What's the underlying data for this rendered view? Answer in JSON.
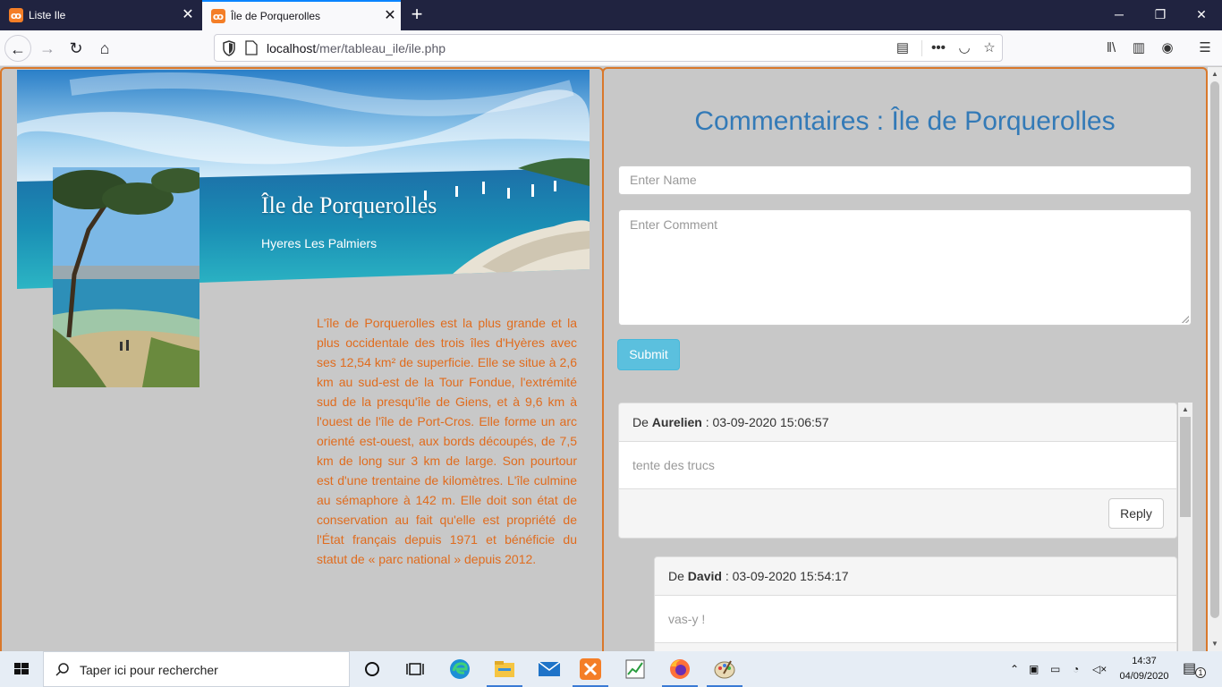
{
  "browser": {
    "tabs": [
      {
        "title": "Liste Ile",
        "active": false,
        "favicon": "xampp-icon"
      },
      {
        "title": "Île de Porquerolles",
        "active": true,
        "favicon": "xampp-icon"
      }
    ],
    "url_host": "localhost",
    "url_path": "/mer/tableau_ile/ile.php"
  },
  "island": {
    "title": "Île de Porquerolles",
    "subtitle": "Hyeres Les Palmiers",
    "description": "L'île de Porquerolles est la plus grande et la plus occidentale des trois îles d'Hyères avec ses 12,54 km² de superficie. Elle se situe à 2,6 km au sud-est de la Tour Fondue, l'extrémité sud de la presqu'île de Giens, et à 9,6 km à l'ouest de l'île de Port-Cros. Elle forme un arc orienté est-ouest, aux bords découpés, de 7,5 km de long sur 3 km de large. Son pourtour est d'une trentaine de kilomètres. L'île culmine au sémaphore à 142 m. Elle doit son état de conservation au fait qu'elle est propriété de l'État français depuis 1971 et bénéficie du statut de « parc national » depuis 2012."
  },
  "comments": {
    "heading": "Commentaires : Île de Porquerolles",
    "name_placeholder": "Enter Name",
    "comment_placeholder": "Enter Comment",
    "submit_label": "Submit",
    "reply_label": "Reply",
    "prefix": "De",
    "items": [
      {
        "author": "Aurelien",
        "date": ": 03-09-2020 15:06:57",
        "text": "tente des trucs"
      },
      {
        "author": "David",
        "date": ": 03-09-2020 15:54:17",
        "text": "vas-y !"
      }
    ]
  },
  "taskbar": {
    "search_placeholder": "Taper ici pour rechercher",
    "time": "14:37",
    "date": "04/09/2020",
    "notification_count": "1"
  },
  "colors": {
    "accent_title": "#337ab7",
    "description_text": "#e06c1e",
    "panel_border": "#d9782b",
    "submit_bg": "#5bc0de",
    "tab_indicator": "#0a84ff"
  }
}
